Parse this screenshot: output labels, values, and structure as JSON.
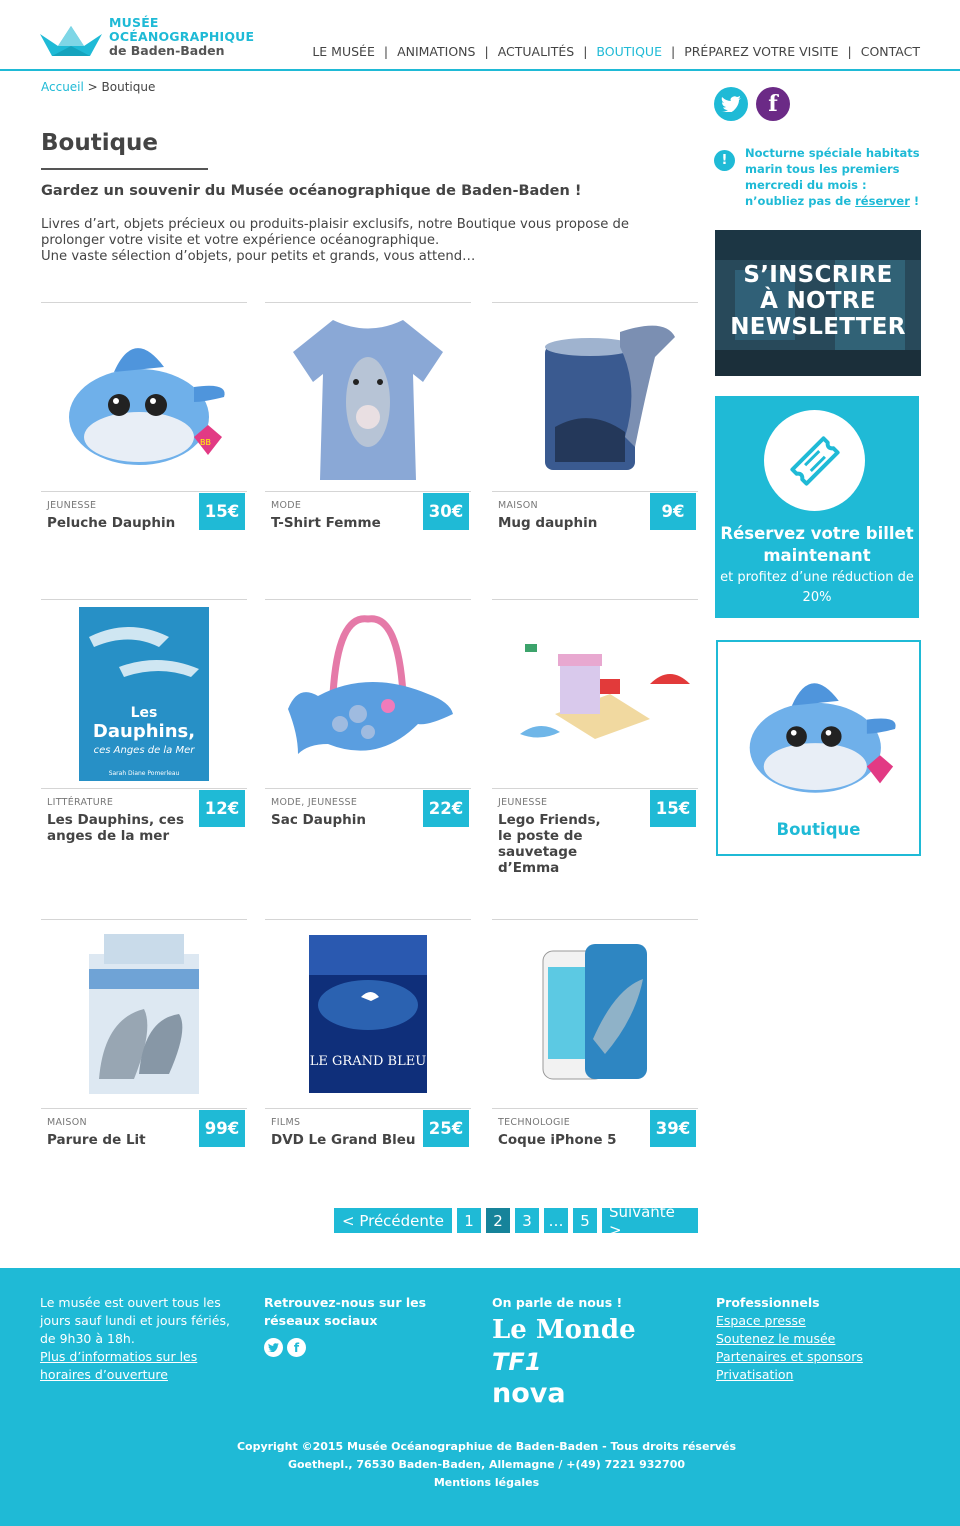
{
  "header": {
    "logo": {
      "line1": "MUSÉE",
      "line2": "OCÉANOGRAPHIQUE",
      "line3": "de Baden-Baden"
    },
    "nav": [
      {
        "label": "LE MUSÉE",
        "active": false
      },
      {
        "label": "ANIMATIONS",
        "active": false
      },
      {
        "label": "ACTUALITÉS",
        "active": false
      },
      {
        "label": "BOUTIQUE",
        "active": true
      },
      {
        "label": "PRÉPAREZ VOTRE VISITE",
        "active": false
      },
      {
        "label": "CONTACT",
        "active": false
      }
    ],
    "separator": "|"
  },
  "breadcrumb": {
    "home": "Accueil",
    "separator": " > ",
    "current": "Boutique"
  },
  "main": {
    "title": "Boutique",
    "subtitle": "Gardez un souvenir du Musée océanographique de Baden-Baden !",
    "intro": [
      "Livres d’art, objets précieux ou produits-plaisir exclusifs, notre Boutique vous propose de",
      "prolonger votre visite et votre expérience océanographique.",
      "Une vaste sélection d’objets, pour petits et grands, vous attend…"
    ]
  },
  "products": [
    {
      "category": "JEUNESSE",
      "name": "Peluche Dauphin",
      "price": "15€",
      "image": "plush-dolphin"
    },
    {
      "category": "MODE",
      "name": "T-Shirt Femme",
      "price": "30€",
      "image": "dolphin-tshirt"
    },
    {
      "category": "MAISON",
      "name": "Mug dauphin",
      "price": "9€",
      "image": "dolphin-mug"
    },
    {
      "category": "LITTÉRATURE",
      "name": "Les Dauphins, ces anges de la mer",
      "price": "12€",
      "image": "dolphin-book",
      "image_text": [
        "Les",
        "Dauphins,",
        "ces Anges de la Mer",
        "Sarah Diane Pomerleau"
      ]
    },
    {
      "category": "MODE, JEUNESSE",
      "name": "Sac Dauphin",
      "price": "22€",
      "image": "dolphin-bag"
    },
    {
      "category": "JEUNESSE",
      "name": "Lego Friends,\nle poste de sauvetage\nd’Emma",
      "price": "15€",
      "image": "lego-set"
    },
    {
      "category": "MAISON",
      "name": "Parure de Lit",
      "price": "99€",
      "image": "bed-linen"
    },
    {
      "category": "FILMS",
      "name": "DVD Le Grand Bleu",
      "price": "25€",
      "image": "dvd-grand-bleu",
      "image_text": [
        "LE GRAND BLEU"
      ]
    },
    {
      "category": "TECHNOLOGIE",
      "name": "Coque iPhone 5",
      "price": "39€",
      "image": "iphone-case"
    }
  ],
  "pagination": {
    "prev": "< Précédente",
    "pages": [
      "1",
      "2",
      "3",
      "…",
      "5"
    ],
    "current": "2",
    "next": "Suivante >"
  },
  "sidebar": {
    "social": [
      {
        "name": "twitter-icon"
      },
      {
        "name": "facebook-icon",
        "glyph": "f"
      }
    ],
    "notice": {
      "icon": "!",
      "text": "Nocturne spéciale habitats marin tous les premiers mercredi du mois : n’oubliez pas de ",
      "link": "réserver",
      "suffix": " !"
    },
    "newsletter": {
      "lines": [
        "S’INSCRIRE",
        "À NOTRE",
        "NEWSLETTER"
      ]
    },
    "ticket": {
      "title": "Réservez votre billet maintenant",
      "text": "et profitez d’une réduction de 20%"
    },
    "boutique": {
      "label": "Boutique"
    }
  },
  "footer": {
    "hours": {
      "text": "Le musée est ouvert tous les jours sauf lundi et jours fériés, de 9h30 à 18h.",
      "link": "Plus d’informatios sur les horaires d’ouverture"
    },
    "social": {
      "title": "Retrouvez-nous sur les réseaux sociaux",
      "fb_glyph": "f"
    },
    "press": {
      "title": "On parle de nous !",
      "logos": [
        "Le Monde",
        "TF1",
        "nova"
      ]
    },
    "pro": {
      "title": "Professionnels",
      "links": [
        "Espace presse",
        "Soutenez le musée",
        "Partenaires et sponsors",
        "Privatisation"
      ]
    },
    "copyright": "Copyright ©2015  Musée Océanographiue de Baden-Baden - Tous droits réservés",
    "address": "Goethepl., 76530 Baden-Baden, Allemagne / +(49) 7221 932700",
    "legal": "Mentions légales"
  },
  "colors": {
    "accent": "#1fbad6",
    "accent_dark": "#16839a",
    "facebook": "#6b2a86",
    "text": "#444444"
  }
}
